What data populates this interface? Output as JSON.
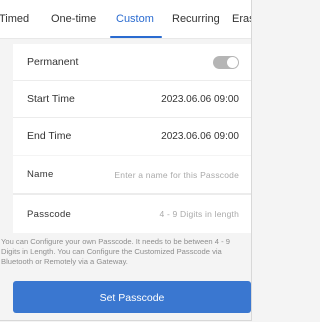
{
  "tabs": [
    {
      "label": "Timed"
    },
    {
      "label": "One-time"
    },
    {
      "label": "Custom",
      "active": true
    },
    {
      "label": "Recurring"
    },
    {
      "label": "Erase"
    }
  ],
  "settings": {
    "permanent_label": "Permanent",
    "permanent_enabled": false,
    "start_time_label": "Start Time",
    "start_time_value": "2023.06.06 09:00",
    "end_time_label": "End Time",
    "end_time_value": "2023.06.06 09:00"
  },
  "form": {
    "name_label": "Name",
    "name_placeholder": "Enter a name for this Passcode",
    "passcode_label": "Passcode",
    "passcode_placeholder": "4 - 9 Digits in length"
  },
  "hint": "You can Configure your own Passcode. It needs to be between 4 - 9 Digits in Length. You can Configure the Customized Passcode via Bluetooth or Remotely via a Gateway.",
  "submit_label": "Set Passcode",
  "colors": {
    "accent": "#2a6bd0",
    "button": "#3a77d0",
    "toggle_off": "#b5b5b5"
  }
}
